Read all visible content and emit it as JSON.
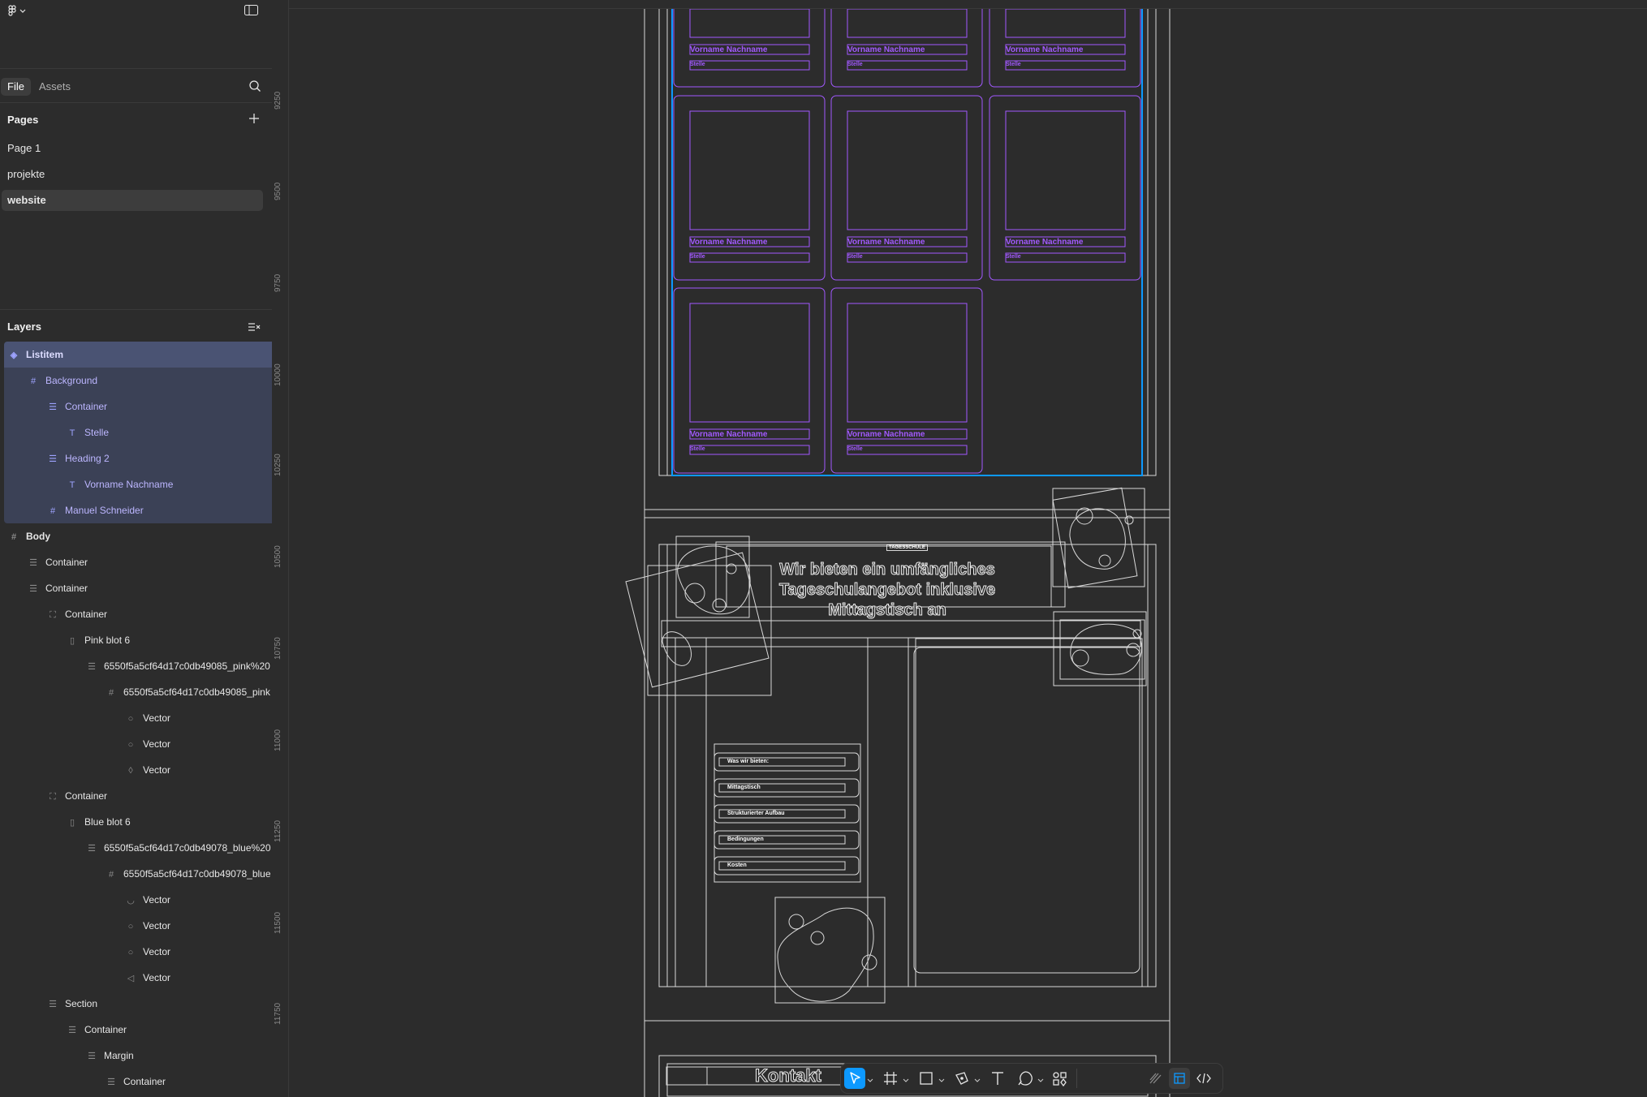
{
  "app": {
    "logo_icon": "figma-icon",
    "panel_icon": "sidebar-toggle-icon"
  },
  "tabs": {
    "file": "File",
    "assets": "Assets"
  },
  "pages": {
    "title": "Pages",
    "items": [
      {
        "label": "Page 1"
      },
      {
        "label": "projekte"
      },
      {
        "label": "website"
      }
    ]
  },
  "layers": {
    "title": "Layers",
    "items": [
      {
        "label": "Listitem",
        "icon": "component"
      },
      {
        "label": "Background",
        "icon": "frame"
      },
      {
        "label": "Container",
        "icon": "auto-layout"
      },
      {
        "label": "Stelle",
        "icon": "text"
      },
      {
        "label": "Heading 2",
        "icon": "auto-layout"
      },
      {
        "label": "Vorname Nachname",
        "icon": "text"
      },
      {
        "label": "Manuel Schneider",
        "icon": "frame"
      },
      {
        "label": "Body",
        "icon": "frame"
      },
      {
        "label": "Container",
        "icon": "auto-layout"
      },
      {
        "label": "Container",
        "icon": "auto-layout"
      },
      {
        "label": "Container",
        "icon": "scale"
      },
      {
        "label": "Pink blot 6",
        "icon": "image"
      },
      {
        "label": "6550f5a5cf64d17c0db49085_pink%20",
        "icon": "auto-layout"
      },
      {
        "label": "6550f5a5cf64d17c0db49085_pink",
        "icon": "frame"
      },
      {
        "label": "Vector",
        "icon": "vector"
      },
      {
        "label": "Vector",
        "icon": "vector"
      },
      {
        "label": "Vector",
        "icon": "vector"
      },
      {
        "label": "Container",
        "icon": "scale"
      },
      {
        "label": "Blue blot 6",
        "icon": "image"
      },
      {
        "label": "6550f5a5cf64d17c0db49078_blue%20",
        "icon": "auto-layout"
      },
      {
        "label": "6550f5a5cf64d17c0db49078_blue",
        "icon": "frame"
      },
      {
        "label": "Vector",
        "icon": "vector"
      },
      {
        "label": "Vector",
        "icon": "vector"
      },
      {
        "label": "Vector",
        "icon": "vector"
      },
      {
        "label": "Vector",
        "icon": "vector"
      },
      {
        "label": "Section",
        "icon": "auto-layout"
      },
      {
        "label": "Container",
        "icon": "auto-layout"
      },
      {
        "label": "Margin",
        "icon": "auto-layout"
      },
      {
        "label": "Container",
        "icon": "auto-layout"
      }
    ]
  },
  "ruler": {
    "labels": [
      "9250",
      "9500",
      "9750",
      "10000",
      "10250",
      "10500",
      "10750",
      "11000",
      "11250",
      "11500",
      "11750"
    ]
  },
  "canvas": {
    "card_name": "Vorname Nachname",
    "card_role": "Stelle",
    "section_tag": "TAGESSCHULE",
    "heading_line1": "Wir bieten ein umfängliches",
    "heading_line2": "Tageschulangebot inklusive",
    "heading_line3": "Mittagstisch an",
    "accordion": [
      "Was wir bieten:",
      "Mittagstisch",
      "Strukturierter Aufbau",
      "Bedingungen",
      "Kosten"
    ],
    "contact": "Kontakt"
  },
  "colors": {
    "accent": "#0d99ff",
    "purple": "#a259ff",
    "selection": "#3b4156"
  },
  "toolbar": {
    "tools": [
      "move-tool",
      "frame-tool",
      "shape-tool",
      "pen-tool",
      "text-tool",
      "comment-tool",
      "actions-tool",
      "draw-mode",
      "design-mode",
      "dev-mode"
    ]
  }
}
